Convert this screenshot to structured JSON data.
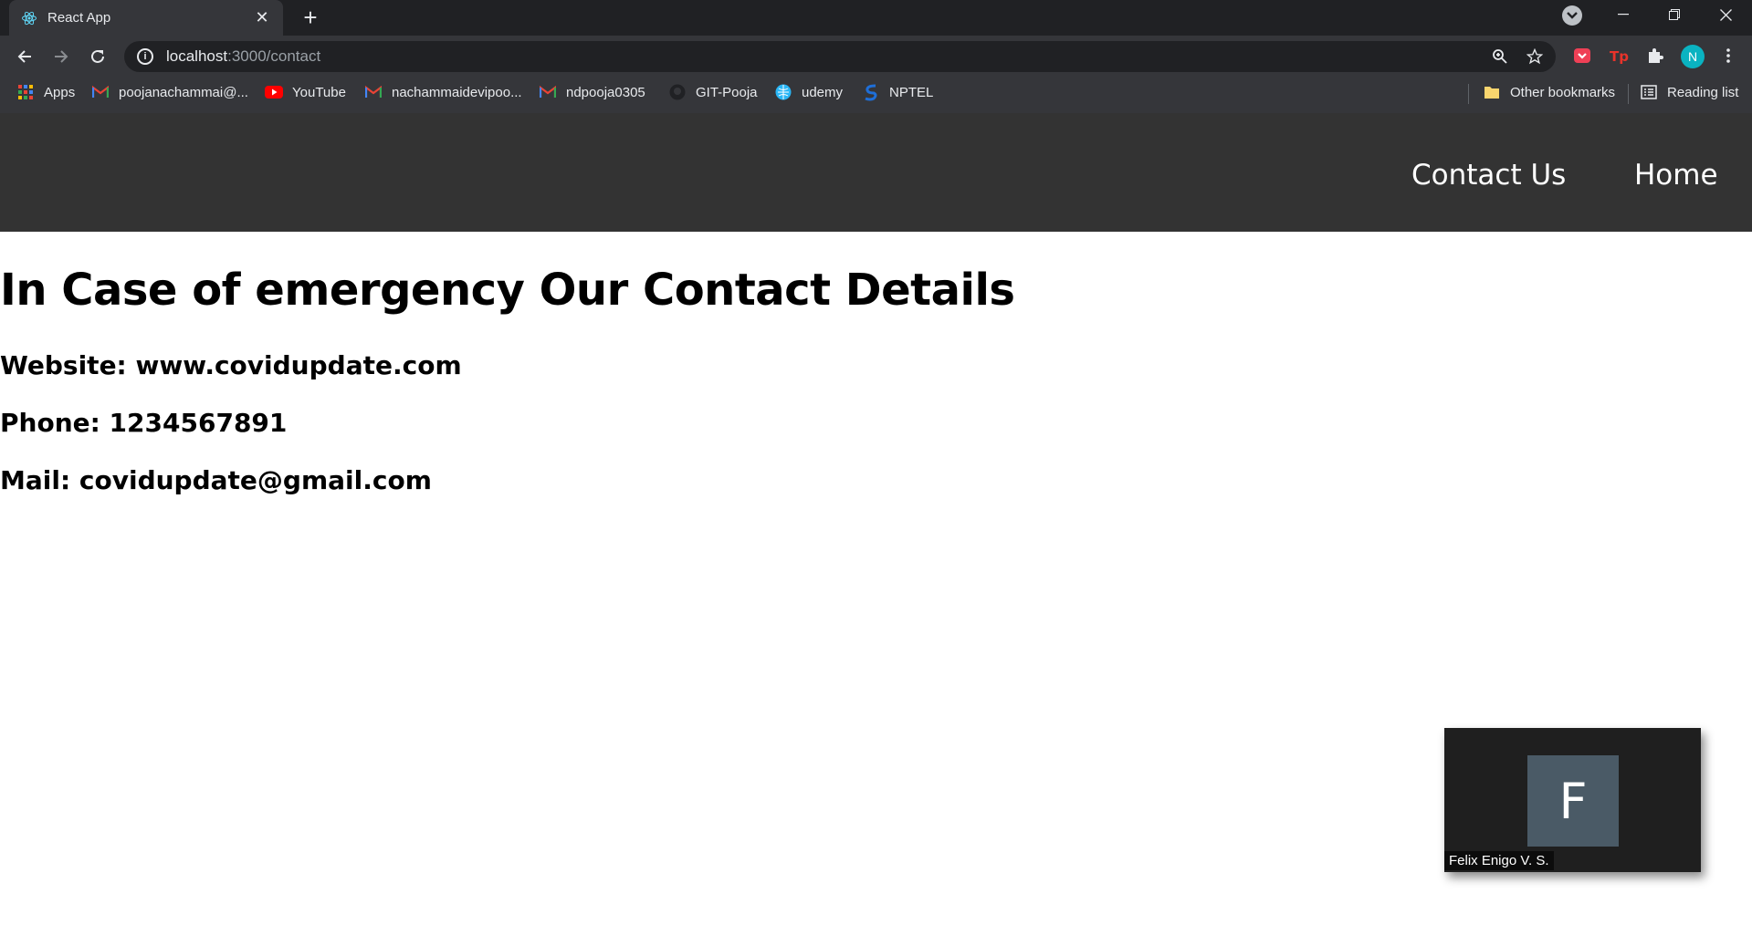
{
  "browser": {
    "tab_title": "React App",
    "tab_close": "✕",
    "new_tab": "+",
    "url_host": "localhost",
    "url_path": ":3000/contact",
    "profile_initial": "N",
    "bookmarks": [
      {
        "label": "Apps",
        "icon": "apps-grid-icon"
      },
      {
        "label": "poojanachammai@...",
        "icon": "gmail-icon"
      },
      {
        "label": "YouTube",
        "icon": "youtube-icon"
      },
      {
        "label": "nachammaidevipoo...",
        "icon": "gmail-icon"
      },
      {
        "label": "ndpooja0305",
        "icon": "gmail-icon"
      },
      {
        "label": "GIT-Pooja",
        "icon": "github-icon"
      },
      {
        "label": "udemy",
        "icon": "udemy-icon"
      },
      {
        "label": "NPTEL",
        "icon": "nptel-icon"
      }
    ],
    "other_bookmarks": "Other bookmarks",
    "reading_list": "Reading list"
  },
  "navbar": {
    "contact_label": "Contact Us",
    "home_label": "Home"
  },
  "main": {
    "heading": "In Case of emergency Our Contact Details",
    "website": "Website: www.covidupdate.com",
    "phone": "Phone: 1234567891",
    "mail": "Mail: covidupdate@gmail.com"
  },
  "video_overlay": {
    "initial": "F",
    "participant_name": "Felix Enigo V. S."
  },
  "colors": {
    "navbar_bg": "#333333",
    "chrome_bg": "#35363a",
    "tabstrip_bg": "#202124",
    "tile_bg": "#4a5a66"
  }
}
